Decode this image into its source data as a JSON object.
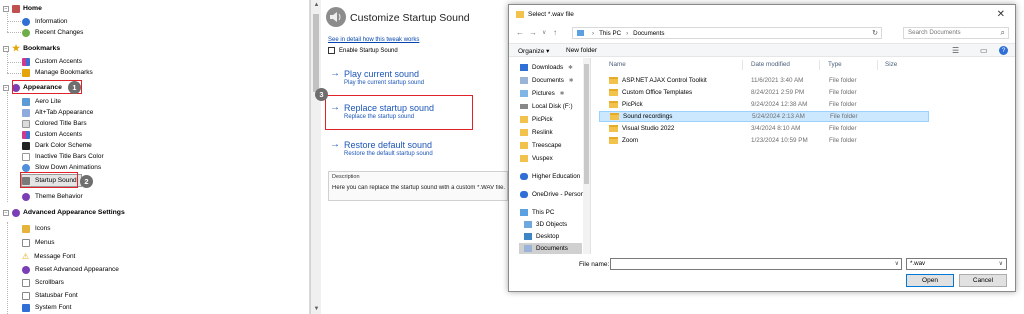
{
  "tree": {
    "categories": {
      "home": "Home",
      "bookmarks": "Bookmarks",
      "appearance": "Appearance",
      "advanced": "Advanced Appearance Settings"
    },
    "home_items": [
      "Information",
      "Recent Changes"
    ],
    "bookmark_items": [
      "Custom Accents",
      "Manage Bookmarks"
    ],
    "appearance_items": [
      "Aero Lite",
      "Alt+Tab Appearance",
      "Colored Title Bars",
      "Custom Accents",
      "Dark Color Scheme",
      "Inactive Title Bars Color",
      "Slow Down Animations",
      "Startup Sound",
      "Theme Behavior"
    ],
    "advanced_items": [
      "Icons",
      "Menus",
      "Message Font",
      "Reset Advanced Appearance",
      "Scrollbars",
      "Statusbar Font",
      "System Font"
    ],
    "badges": [
      "1",
      "2",
      "3"
    ]
  },
  "panel": {
    "title": "Customize Startup Sound",
    "see_detail_link": "See in detail how this tweak works",
    "enable_checkbox_label": "Enable Startup Sound",
    "commands": [
      {
        "title": "Play current sound",
        "subtitle": "Play the current startup sound"
      },
      {
        "title": "Replace startup sound",
        "subtitle": "Replace the startup sound"
      },
      {
        "title": "Restore default sound",
        "subtitle": "Restore the default startup sound"
      }
    ],
    "description_header": "Description",
    "description_text": "Here you can replace the startup sound with a custom *.WAV file. Cl"
  },
  "dialog": {
    "title": "Select *.wav file",
    "breadcrumb": [
      "This PC",
      "Documents"
    ],
    "search_placeholder": "Search Documents",
    "organize_label": "Organize ▾",
    "new_folder_label": "New folder",
    "nav_items": [
      "Downloads",
      "Documents",
      "Pictures",
      "Local Disk (F:)",
      "PicPick",
      "Reslink",
      "Treescape",
      "Vuspex",
      "Higher Education",
      "OneDrive - Person",
      "This PC",
      "3D Objects",
      "Desktop",
      "Documents"
    ],
    "columns": [
      "Name",
      "Date modified",
      "Type",
      "Size"
    ],
    "files": [
      {
        "name": "ASP.NET AJAX Control Toolkit",
        "date": "11/6/2021 3:40 AM",
        "type": "File folder"
      },
      {
        "name": "Custom Office Templates",
        "date": "8/24/2021 2:59 PM",
        "type": "File folder"
      },
      {
        "name": "PicPick",
        "date": "9/24/2024 12:38 AM",
        "type": "File folder"
      },
      {
        "name": "Sound recordings",
        "date": "5/24/2024 2:13 AM",
        "type": "File folder"
      },
      {
        "name": "Visual Studio 2022",
        "date": "3/4/2024 8:10 AM",
        "type": "File folder"
      },
      {
        "name": "Zoom",
        "date": "1/23/2024 10:59 PM",
        "type": "File folder"
      }
    ],
    "filename_label": "File name:",
    "filename_value": "",
    "filetype_value": "*.wav",
    "open_label": "Open",
    "cancel_label": "Cancel"
  },
  "colors": {
    "highlight_red": "#e0222b",
    "link_blue": "#1c56b8",
    "selection_blue": "#cce8ff",
    "badge_gray": "#6e6e6e"
  }
}
